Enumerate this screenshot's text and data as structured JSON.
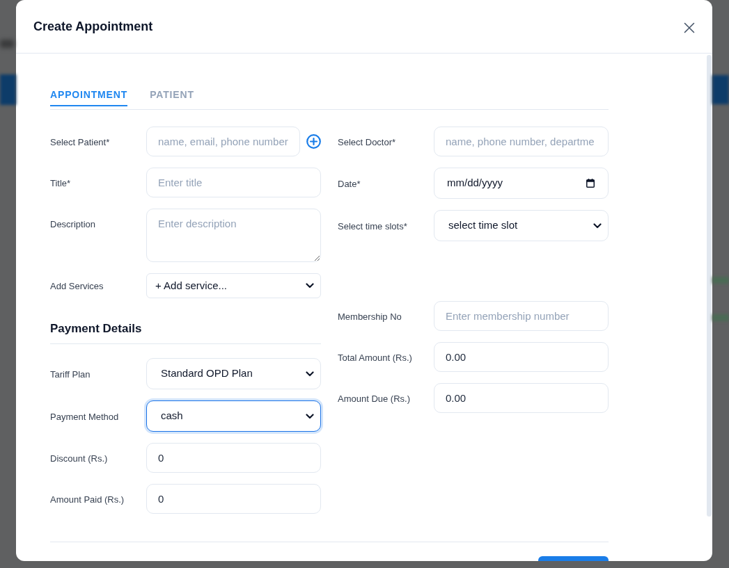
{
  "dialog": {
    "title": "Create Appointment"
  },
  "tabs": [
    {
      "label": "APPOINTMENT",
      "selected": true
    },
    {
      "label": "PATIENT",
      "selected": false
    }
  ],
  "appointment": {
    "left": [
      {
        "kind": "input_add",
        "label": "Select Patient*",
        "placeholder": "name, email, phone number"
      },
      {
        "kind": "input",
        "label": "Title*",
        "placeholder": "Enter title"
      },
      {
        "kind": "textarea",
        "label": "Description",
        "placeholder": "Enter description"
      },
      {
        "kind": "compact_select",
        "label": "Add Services",
        "value": "+ Add service..."
      }
    ],
    "right": [
      {
        "kind": "input",
        "label": "Select Doctor*",
        "placeholder": "name, phone number, departme"
      },
      {
        "kind": "date",
        "label": "Date*",
        "value": "mm/dd/yyyy"
      },
      {
        "kind": "select",
        "label": "Select time slots*",
        "value": "select time slot"
      }
    ]
  },
  "payment": {
    "heading": "Payment Details",
    "left": [
      {
        "kind": "select",
        "label": "Tariff Plan",
        "value": "Standard OPD Plan",
        "focused": false
      },
      {
        "kind": "select",
        "label": "Payment Method",
        "value": "cash",
        "focused": true
      },
      {
        "kind": "input",
        "label": "Discount (Rs.)",
        "value": "0",
        "focused": false
      },
      {
        "kind": "input",
        "label": "Amount Paid (Rs.)",
        "value": "0",
        "focused": false
      }
    ],
    "right": [
      {
        "kind": "input",
        "label": "Membership No",
        "placeholder": "Enter membership number"
      },
      {
        "kind": "input",
        "label": "Total Amount (Rs.)",
        "value": "0.00"
      },
      {
        "kind": "input",
        "label": "Amount Due (Rs.)",
        "value": "0.00"
      }
    ]
  }
}
